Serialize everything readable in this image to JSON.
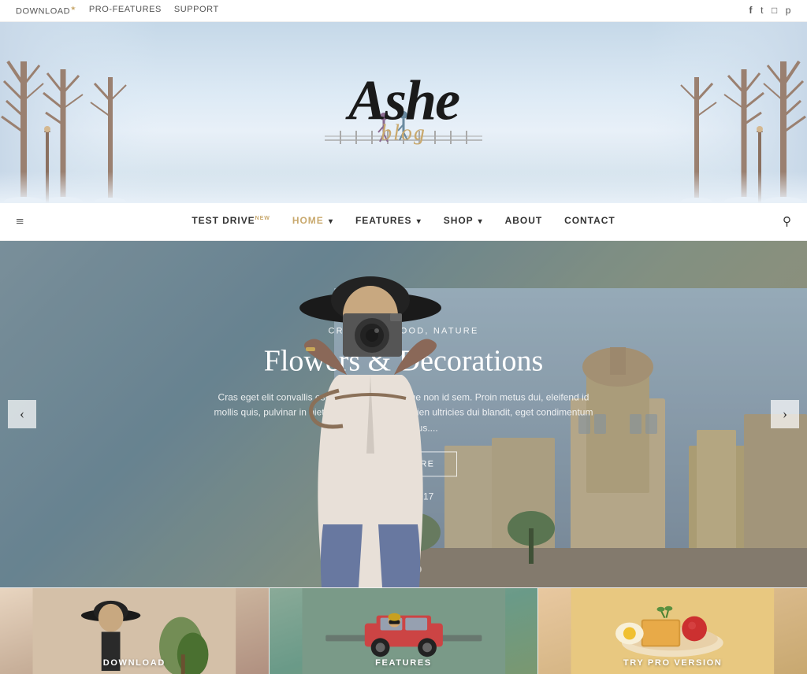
{
  "topbar": {
    "links": [
      {
        "label": "DOWNLOAD",
        "sup": "★",
        "id": "download"
      },
      {
        "label": "PRO-FEATURES",
        "id": "pro-features"
      },
      {
        "label": "SUPPORT",
        "id": "support"
      }
    ],
    "social": [
      "f",
      "t",
      "ig",
      "p"
    ]
  },
  "header": {
    "site_title": "Ashe",
    "site_subtitle": "blog"
  },
  "nav": {
    "hamburger": "≡",
    "items": [
      {
        "label": "TEST DRIVE",
        "sup": "NEW",
        "active": false,
        "has_dropdown": false
      },
      {
        "label": "HOME",
        "active": true,
        "has_dropdown": true
      },
      {
        "label": "FEATURES",
        "active": false,
        "has_dropdown": true
      },
      {
        "label": "SHOP",
        "active": false,
        "has_dropdown": true
      },
      {
        "label": "ABOUT",
        "active": false,
        "has_dropdown": false
      },
      {
        "label": "CONTACT",
        "active": false,
        "has_dropdown": false
      }
    ],
    "search_icon": "🔍"
  },
  "hero": {
    "category": "CREATIVE, FOOD, NATURE",
    "title": "Flowers & Decorations",
    "excerpt": "Cras eget elit convallis est condimentum congue non id sem. Proin metus dui, eleifend id mollis quis, pulvinar in nietus. Nulla pharetra sapien ultricies dui blandit, eget condimentum tortor rhoncus....",
    "read_more": "READ MORE",
    "date": "March 7, 2017",
    "dots": [
      true,
      false,
      false
    ]
  },
  "cards": [
    {
      "label": "DOWNLOAD",
      "bg": "card-bg-1"
    },
    {
      "label": "FEATURES",
      "bg": "card-bg-2"
    },
    {
      "label": "TRY PRO VERSION",
      "bg": "card-bg-3"
    }
  ]
}
